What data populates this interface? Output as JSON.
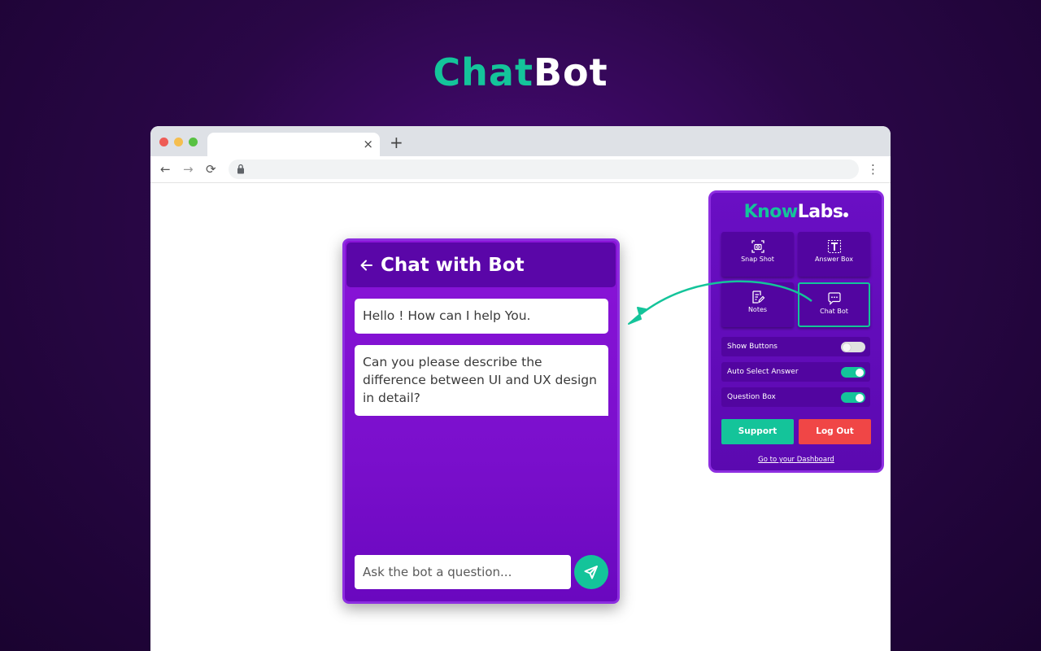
{
  "hero": {
    "title_accent": "Chat",
    "title_rest": "Bot"
  },
  "browser": {
    "tab_close": "×",
    "new_tab": "+",
    "nav_back": "←",
    "nav_forward": "→",
    "nav_reload": "⟳",
    "menu": "⋮"
  },
  "chat": {
    "back_icon": "arrow-left-icon",
    "title": "Chat with Bot",
    "messages": [
      {
        "text": "Hello ! How can I help You."
      },
      {
        "text": "Can you please describe the difference between UI and UX design in detail?"
      }
    ],
    "input": {
      "placeholder": "Ask the bot a question...",
      "value": ""
    },
    "send_icon": "send-icon"
  },
  "popup": {
    "brand_accent": "Know",
    "brand_rest": "Labs",
    "tiles": [
      {
        "label": "Snap Shot",
        "icon": "snapshot-icon"
      },
      {
        "label": "Answer Box",
        "icon": "text-box-icon"
      },
      {
        "label": "Notes",
        "icon": "notes-icon"
      },
      {
        "label": "Chat Bot",
        "icon": "chat-bubble-icon",
        "active": true
      }
    ],
    "toggles": [
      {
        "label": "Show Buttons",
        "on": false
      },
      {
        "label": "Auto Select Answer",
        "on": true
      },
      {
        "label": "Question Box",
        "on": true
      }
    ],
    "support_label": "Support",
    "logout_label": "Log Out",
    "dashboard_link": "Go to your Dashboard"
  },
  "colors": {
    "accent_green": "#14c49a",
    "purple_dark": "#5a06a8",
    "logout_red": "#f04646"
  }
}
